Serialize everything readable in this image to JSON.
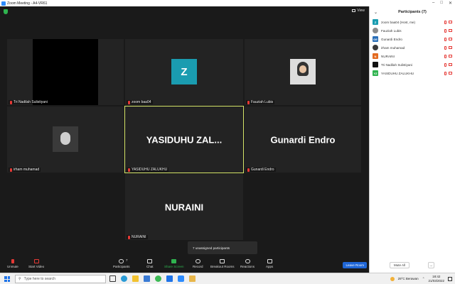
{
  "window": {
    "title": "Zoom Meeting - A4-VR61"
  },
  "topbar": {
    "view_label": "View"
  },
  "tiles": [
    {
      "name": "Tri Nadilah Sulistiyani",
      "kind": "black"
    },
    {
      "name": "zoom baa04",
      "kind": "avatar",
      "avatar_letter": "Z",
      "avatar_color": "#1a9cb0"
    },
    {
      "name": "Fauziah Lubis",
      "kind": "photo"
    },
    {
      "name": "irham muhamad",
      "kind": "photo"
    },
    {
      "name": "YASIDUHU ZALUKHU",
      "kind": "text",
      "big_text": "YASIDUHU  ZAL..."
    },
    {
      "name": "Gunardi Endro",
      "kind": "text",
      "big_text": "Gunardi Endro"
    },
    {
      "name": "NURAINI",
      "kind": "text",
      "big_text": "NURAINI"
    }
  ],
  "panel": {
    "title": "Participants (7)",
    "participants": [
      {
        "name": "zoom baa04 (Host, me)",
        "initials": "Z",
        "color": "#1a9cb0"
      },
      {
        "name": "Fauziah Lubis",
        "initials": "",
        "color": "#8c8c8c"
      },
      {
        "name": "Gunardi Endro",
        "initials": "GE",
        "color": "#2a6fb8"
      },
      {
        "name": "irham muhamad",
        "initials": "",
        "color": "#3a3a3a"
      },
      {
        "name": "NURAINI",
        "initials": "N",
        "color": "#e36a1f"
      },
      {
        "name": "Tri Nadilah Sulistiyani",
        "initials": "",
        "color": "#111111"
      },
      {
        "name": "YASIDUHU ZALUKHU",
        "initials": "YZ",
        "color": "#2fb34f"
      }
    ],
    "mute_all_label": "Mute All",
    "more_label": "..."
  },
  "toolbar": {
    "unmute": "Unmute",
    "start_video": "Start Video",
    "participants": "Participants",
    "participants_count": "7",
    "chat": "Chat",
    "share_screen": "Share Screen",
    "record": "Record",
    "breakout": "Breakout Rooms",
    "reactions": "Reactions",
    "apps": "Apps",
    "leave": "Leave Room"
  },
  "popover": {
    "text": "7 unassigned participants"
  },
  "taskbar": {
    "search_placeholder": "Type here to search",
    "weather": "29°C  Berawan",
    "time": "18:42",
    "date": "21/03/2022"
  }
}
